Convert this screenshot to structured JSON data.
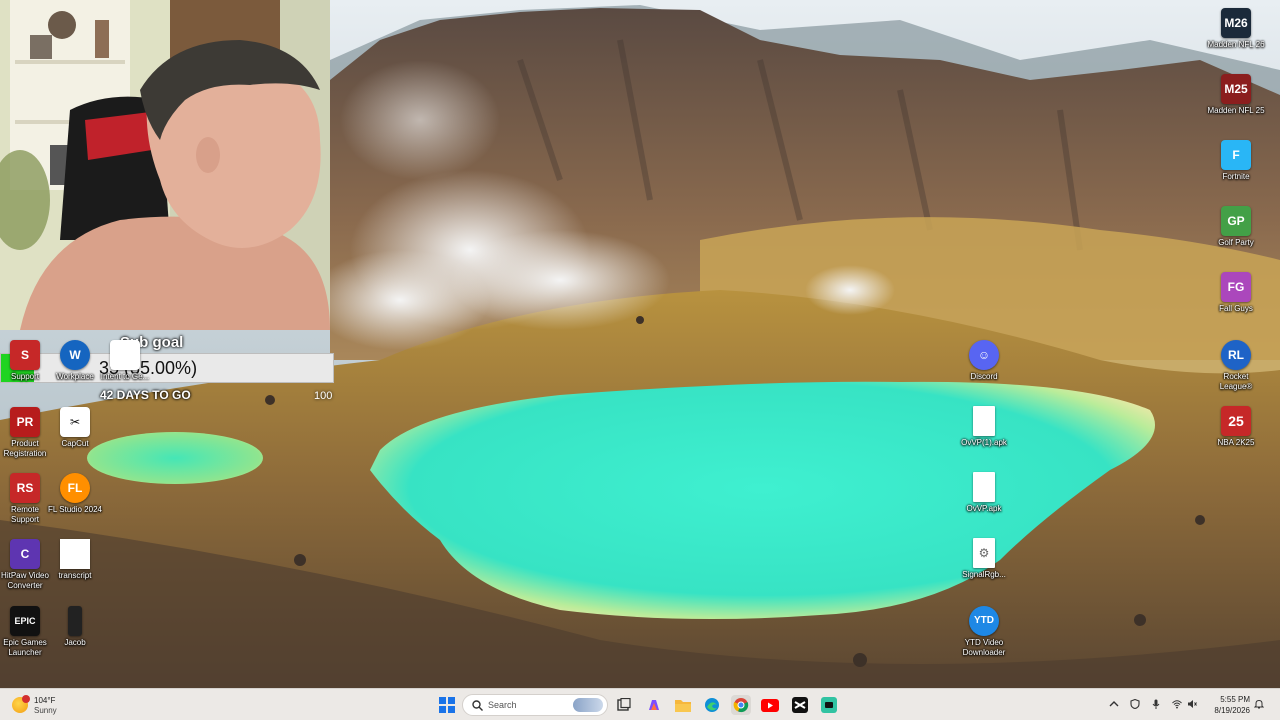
{
  "stream_overlay": {
    "sub_goal": {
      "title": "Sub goal",
      "progress_text": "35 (35.00%)",
      "progress_fraction": 0.35,
      "days_left": "42 DAYS TO GO",
      "target": "100"
    }
  },
  "desktop": {
    "left_icons": [
      {
        "label": "Support",
        "icon": "support-app-icon",
        "color": "#c62828"
      },
      {
        "label": "Workplace",
        "icon": "workplace-app-icon",
        "color": "#1565c0"
      },
      {
        "label": "Intent to Ge...",
        "icon": "document-icon",
        "color": "#ffffff"
      },
      {
        "label": "Product Registration",
        "icon": "product-registration-icon",
        "color": "#b71c1c"
      },
      {
        "label": "CapCut",
        "icon": "capcut-icon",
        "color": "#ffffff"
      },
      {
        "label": "Remote Support",
        "icon": "remote-support-icon",
        "color": "#c62828"
      },
      {
        "label": "FL Studio 2024",
        "icon": "fl-studio-icon",
        "color": "#ff8f00"
      },
      {
        "label": "HitPaw Video Converter",
        "icon": "hitpaw-icon",
        "color": "#5e35b1"
      },
      {
        "label": "transcript",
        "icon": "document-icon",
        "color": "#ffffff"
      },
      {
        "label": "Epic Games Launcher",
        "icon": "epic-games-icon",
        "color": "#111111"
      },
      {
        "label": "Jacob",
        "icon": "phone-icon",
        "color": "#222222"
      }
    ],
    "middle_icons": [
      {
        "label": "Discord",
        "icon": "discord-icon",
        "color": "#5865f2"
      },
      {
        "label": "OvVP(1).apk",
        "icon": "apk-file-icon",
        "color": "#ffffff"
      },
      {
        "label": "OvVP.apk",
        "icon": "apk-file-icon",
        "color": "#ffffff"
      },
      {
        "label": "SignalRgb...",
        "icon": "settings-file-icon",
        "color": "#ffffff"
      },
      {
        "label": "YTD Video Downloader",
        "icon": "ytd-icon",
        "color": "#1e88e5"
      }
    ],
    "right_icons": [
      {
        "label": "Madden NFL 26",
        "short": "M26",
        "icon": "madden-26-icon",
        "color": "#1b2a3a"
      },
      {
        "label": "Madden NFL 25",
        "short": "M25",
        "icon": "madden-25-icon",
        "color": "#8b1e1e"
      },
      {
        "label": "Fortnite",
        "short": "F",
        "icon": "fortnite-icon",
        "color": "#29b6f6"
      },
      {
        "label": "Golf Party",
        "short": "GP",
        "icon": "golf-party-icon",
        "color": "#43a047"
      },
      {
        "label": "Fall Guys",
        "short": "FG",
        "icon": "fall-guys-icon",
        "color": "#ab47bc"
      },
      {
        "label": "Rocket League®",
        "short": "RL",
        "icon": "rocket-league-icon",
        "color": "#1e63c7"
      },
      {
        "label": "NBA 2K25",
        "short": "25",
        "icon": "nba-2k25-icon",
        "color": "#c62828"
      }
    ]
  },
  "taskbar": {
    "weather": {
      "temp": "104°F",
      "condition": "Sunny"
    },
    "search_label": "Search",
    "apps": [
      {
        "name": "start-button",
        "color": "#1a73e8"
      },
      {
        "name": "task-view-icon",
        "color": "#333333"
      },
      {
        "name": "copilot-icon",
        "color": "#7c4dff"
      },
      {
        "name": "file-explorer-icon",
        "color": "#f6b73c"
      },
      {
        "name": "edge-icon",
        "color": "#0f8fd6"
      },
      {
        "name": "chrome-icon",
        "color": "#db4437"
      },
      {
        "name": "youtube-icon",
        "color": "#ff0000"
      },
      {
        "name": "capcut-taskbar-icon",
        "color": "#111111"
      },
      {
        "name": "streamlabs-icon",
        "color": "#31c3a2"
      }
    ],
    "clock": {
      "time": "5:55 PM",
      "date": "8/19/2026"
    }
  }
}
